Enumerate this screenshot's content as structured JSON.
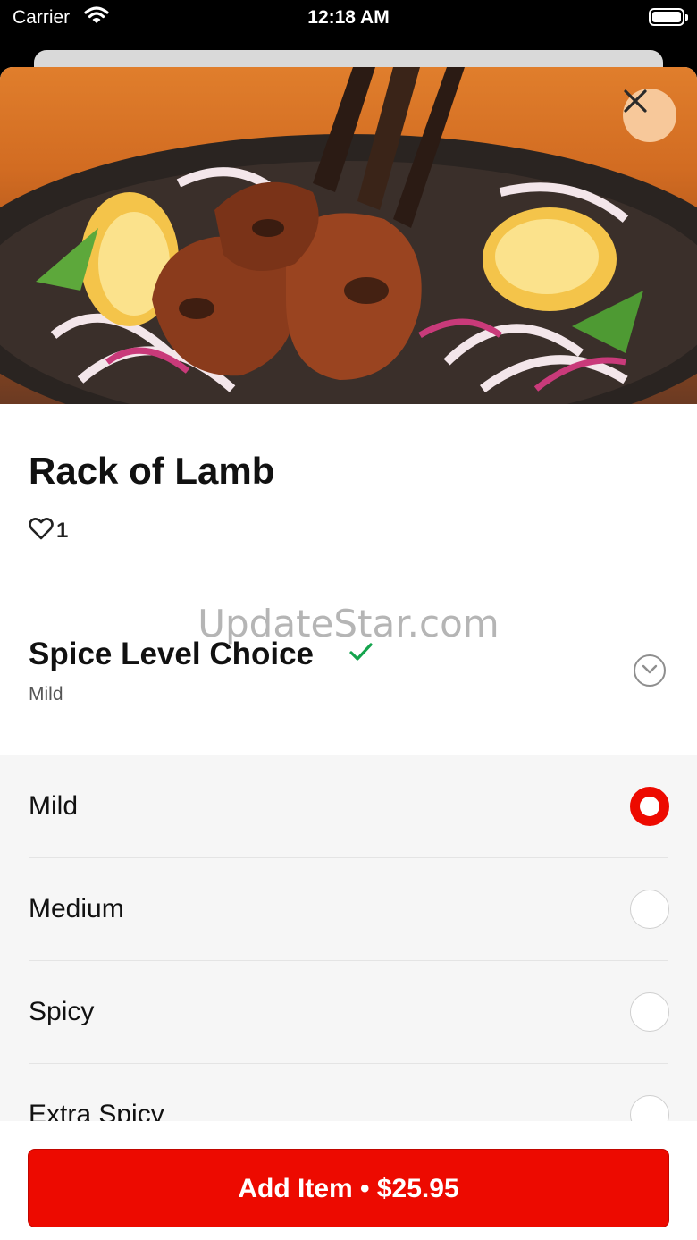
{
  "status_bar": {
    "carrier": "Carrier",
    "time": "12:18 AM"
  },
  "item": {
    "title": "Rack of Lamb",
    "likes": "1"
  },
  "watermark": "UpdateStar.com",
  "section": {
    "title": "Spice Level Choice",
    "selected_value": "Mild"
  },
  "options": [
    {
      "label": "Mild",
      "selected": true
    },
    {
      "label": "Medium",
      "selected": false
    },
    {
      "label": "Spicy",
      "selected": false
    },
    {
      "label": "Extra Spicy",
      "selected": false
    }
  ],
  "footer": {
    "add_button_label": "Add Item • $25.95"
  },
  "colors": {
    "accent": "#ed0a00",
    "check": "#14a44d",
    "close_button_bg": "#f7c89a"
  },
  "icons": {
    "close": "close-icon",
    "heart": "heart-icon",
    "check": "check-icon",
    "chevron": "chevron-down-icon"
  }
}
